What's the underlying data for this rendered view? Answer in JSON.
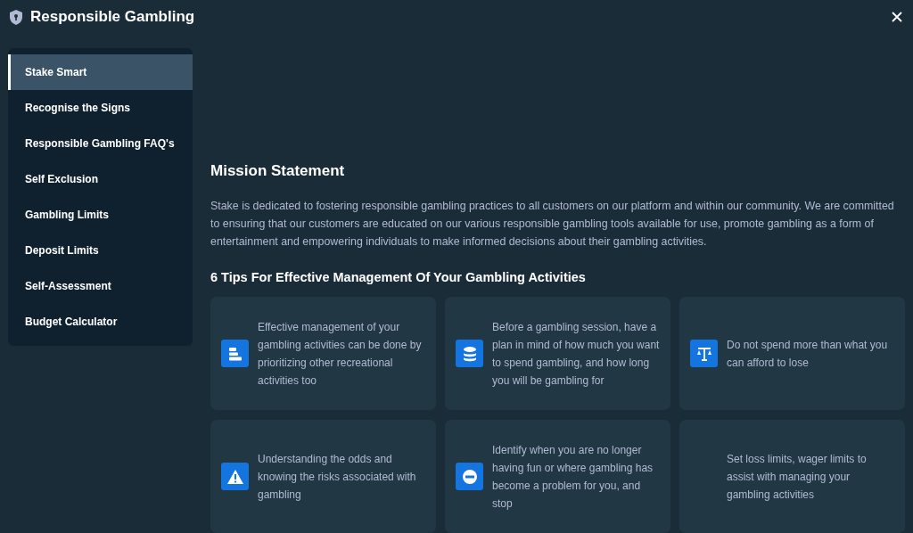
{
  "window": {
    "title": "Responsible Gambling"
  },
  "sidebar": {
    "items": [
      {
        "label": "Stake Smart",
        "selected": true
      },
      {
        "label": "Recognise the Signs",
        "selected": false
      },
      {
        "label": "Responsible Gambling FAQ's",
        "selected": false
      },
      {
        "label": "Self Exclusion",
        "selected": false
      },
      {
        "label": "Gambling Limits",
        "selected": false
      },
      {
        "label": "Deposit Limits",
        "selected": false
      },
      {
        "label": "Self-Assessment",
        "selected": false
      },
      {
        "label": "Budget Calculator",
        "selected": false
      }
    ]
  },
  "mission": {
    "heading": "Mission Statement",
    "body": "Stake is dedicated to fostering responsible gambling practices to all customers on our platform and within our community. We are committed to ensuring that our customers are educated on our various responsible gambling tools available for use, promote gambling as a form of entertainment and empowering individuals to make informed decisions about their gambling activities."
  },
  "tips": {
    "heading": "6 Tips For Effective Management Of Your Gambling Activities",
    "cards": [
      {
        "kind": "bars",
        "text": "Effective management of your gambling activities can be done by prioritizing other recreational activities too"
      },
      {
        "kind": "coins",
        "text": "Before a gambling session, have a plan in mind of how much you want to spend gambling, and how long you will be gambling for"
      },
      {
        "kind": "scales",
        "text": "Do not spend more than what you can afford to lose"
      },
      {
        "kind": "warning",
        "text": "Understanding the odds and knowing the risks associated with gambling"
      },
      {
        "kind": "stop",
        "text": "Identify when you are no longer having fun or where gambling has become a problem for you, and stop"
      },
      {
        "kind": "plain",
        "text": "Set loss limits, wager limits to assist with managing your gambling activities"
      }
    ]
  }
}
